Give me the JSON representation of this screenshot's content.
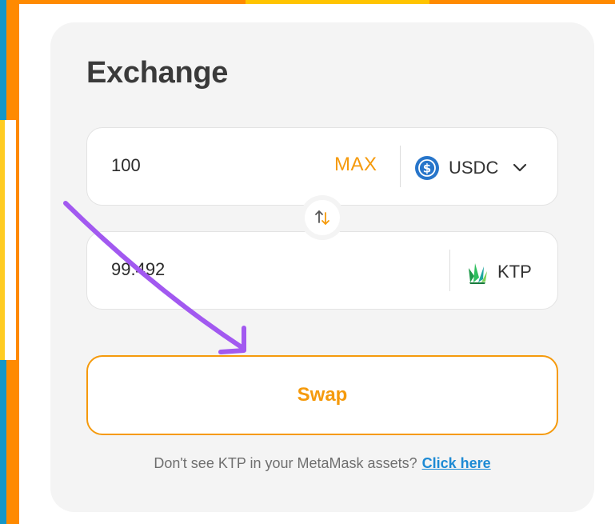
{
  "exchange": {
    "title": "Exchange",
    "from": {
      "value": "100",
      "max_label": "MAX",
      "token": "USDC",
      "token_icon": "usdc-icon"
    },
    "to": {
      "value": "99.492",
      "token": "KTP",
      "token_icon": "ktp-leaf-icon"
    },
    "swap_direction_icon": "swap-arrows-icon",
    "swap_label": "Swap",
    "hint_text": "Don't see KTP in your MetaMask assets?",
    "hint_link": "Click here"
  },
  "colors": {
    "accent": "#f59a0c",
    "link": "#1d8ad4",
    "usdc": "#2775ca",
    "annotation": "#a259f0",
    "card_bg": "#f4f4f4"
  }
}
